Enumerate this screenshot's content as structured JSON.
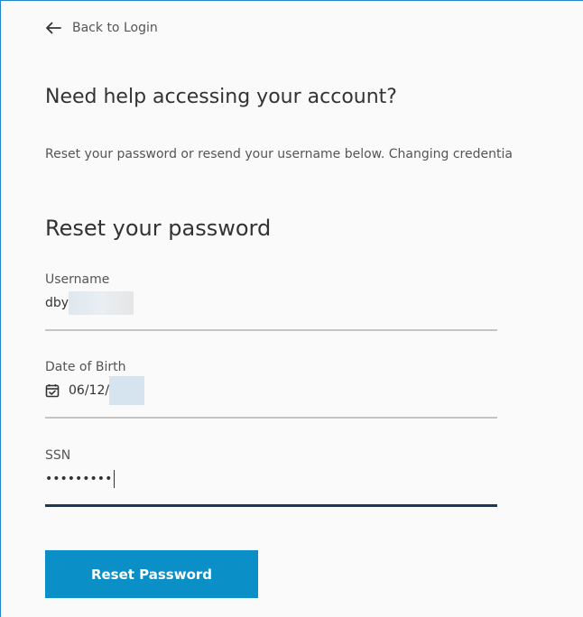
{
  "back_link": {
    "label": "Back to Login",
    "icon": "arrow-left-icon"
  },
  "page_title": "Need help accessing your account?",
  "intro_text": "Reset your password or resend your username below. Changing credentia",
  "reset_section": {
    "title": "Reset your password",
    "fields": {
      "username": {
        "label": "Username",
        "value": "dby"
      },
      "dob": {
        "label": "Date of Birth",
        "value": "06/12/",
        "icon": "calendar-check-icon"
      },
      "ssn": {
        "label": "SSN",
        "value": "•••••••••"
      }
    },
    "submit_label": "Reset Password"
  },
  "colors": {
    "accent": "#0a8fc7",
    "active_underline": "#1a3a5c",
    "frame_border": "#1f86c7"
  }
}
